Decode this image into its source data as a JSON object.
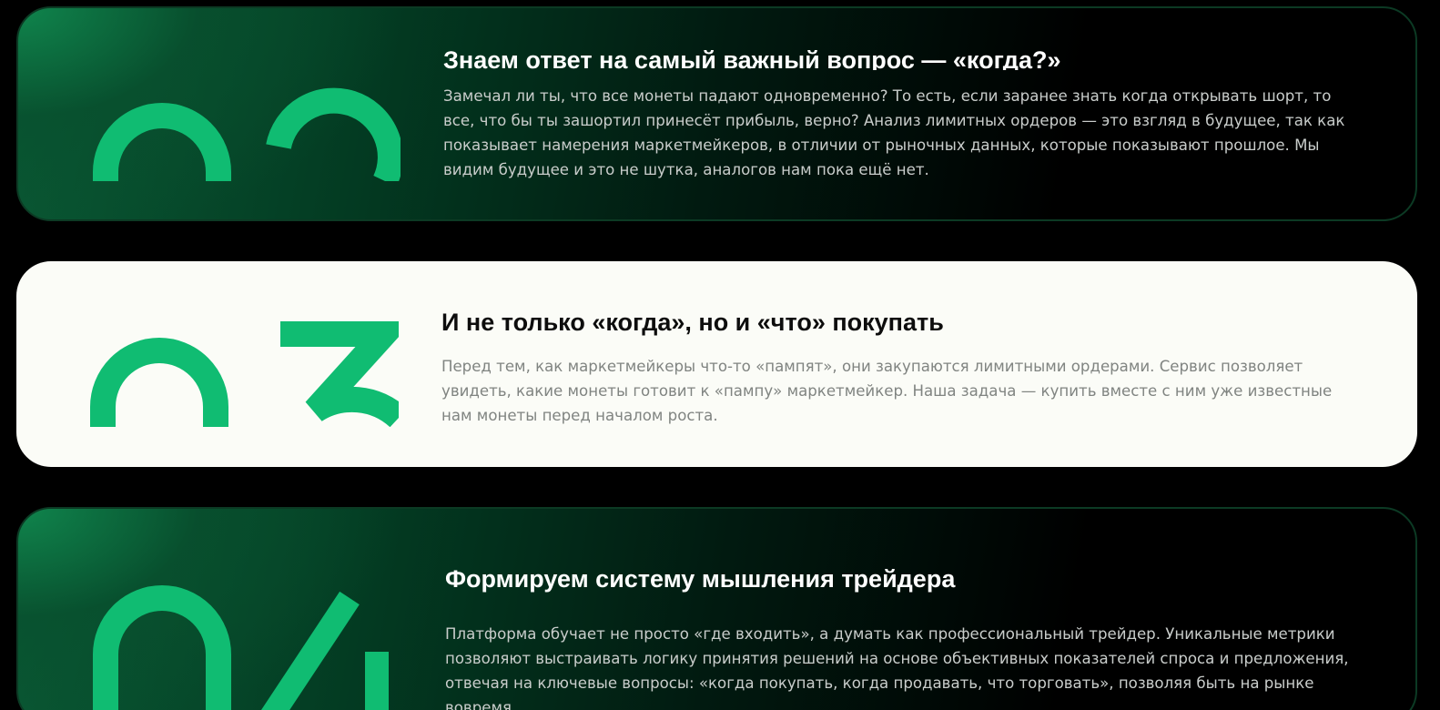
{
  "accent_color": "#10bc72",
  "cards": [
    {
      "number_icon": "digits-02-icon",
      "title": "Знаем ответ на самый важный вопрос — «когда?»",
      "description": "Замечал ли ты, что все монеты падают одновременно? То есть, если заранее знать когда открывать шорт, то все, что бы ты зашортил принесёт прибыль, верно?  Анализ лимитных ордеров — это взгляд в будущее, так как показывает намерения маркетмейкеров, в отличии от рыночных данных, которые показывают прошлое. Мы видим будущее и это не шутка, аналогов нам пока ещё нет."
    },
    {
      "number_icon": "digits-03-icon",
      "title": "И не только «когда», но и «что» покупать",
      "description": "Перед тем, как маркетмейкеры что-то «пампят», они закупаются лимитными ордерами. Сервис позволяет увидеть, какие монеты готовит к «пампу» маркетмейкер.  Наша задача — купить вместе с ним уже известные нам монеты перед началом роста."
    },
    {
      "number_icon": "digits-04-icon",
      "title": "Формируем систему мышления трейдера",
      "description": "Платформа обучает не просто «где входить», а думать как профессиональный трейдер.  Уникальные метрики позволяют выстраивать логику принятия решений на основе объективных показателей спроса и предложения, отвечая на ключевые вопросы: «когда покупать, когда продавать, что торговать», позволяя быть на рынке вовремя."
    }
  ]
}
